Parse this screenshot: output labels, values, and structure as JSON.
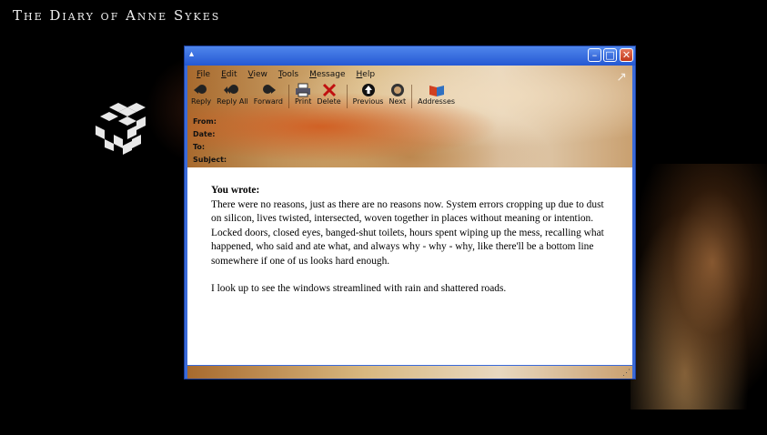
{
  "site_title": "The Diary of Anne Sykes",
  "window": {
    "menu": [
      "File",
      "Edit",
      "View",
      "Tools",
      "Message",
      "Help"
    ],
    "toolbar": [
      {
        "label": "Reply",
        "icon": "reply-icon"
      },
      {
        "label": "Reply All",
        "icon": "reply-all-icon"
      },
      {
        "label": "Forward",
        "icon": "forward-icon"
      },
      {
        "label": "Print",
        "icon": "print-icon"
      },
      {
        "label": "Delete",
        "icon": "delete-icon"
      },
      {
        "label": "Previous",
        "icon": "previous-icon"
      },
      {
        "label": "Next",
        "icon": "next-icon"
      },
      {
        "label": "Addresses",
        "icon": "addresses-icon"
      }
    ],
    "headers": {
      "from": "From:",
      "date": "Date:",
      "to": "To:",
      "subject": "Subject:"
    },
    "message": {
      "heading": "You wrote:",
      "paragraph1": "There were no reasons, just as there are no reasons now. System errors cropping up due to dust on silicon, lives twisted, intersected, woven together in places without meaning or intention.  Locked doors, closed eyes, banged-shut toilets, hours spent wiping up the mess, recalling what happened, who said and ate what, and always why - why - why, like there'll be a bottom line somewhere if one of us looks hard enough.",
      "paragraph2": "I look up to see the windows streamlined with rain and shattered roads."
    }
  }
}
